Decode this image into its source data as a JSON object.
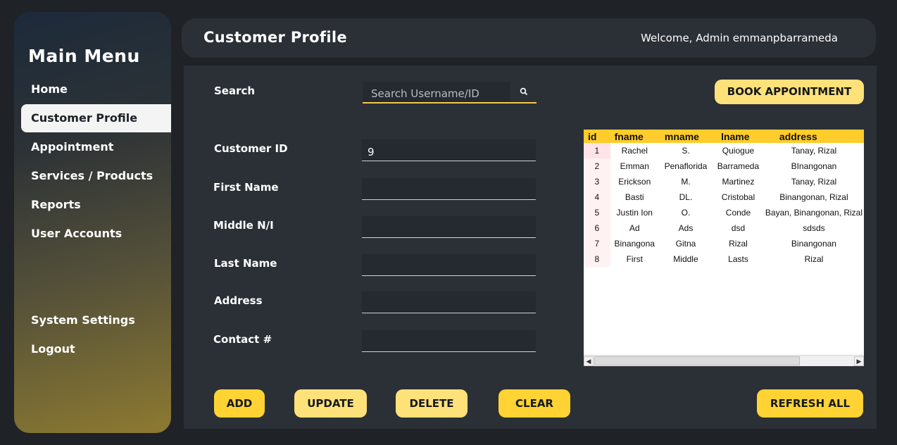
{
  "sidebar": {
    "title": "Main Menu",
    "items": [
      {
        "label": "Home"
      },
      {
        "label": "Customer Profile"
      },
      {
        "label": "Appointment"
      },
      {
        "label": "Services / Products"
      },
      {
        "label": "Reports"
      },
      {
        "label": "User Accounts"
      },
      {
        "label": "System Settings"
      },
      {
        "label": "Logout"
      }
    ],
    "active_index": 1
  },
  "header": {
    "title": "Customer Profile",
    "welcome": "Welcome, Admin emmanpbarrameda"
  },
  "search": {
    "label": "Search",
    "placeholder": "Search Username/ID",
    "icon": "search-icon"
  },
  "book_button": "BOOK APPOINTMENT",
  "form": {
    "customer_id_label": "Customer ID",
    "customer_id_value": "9",
    "first_name_label": "First Name",
    "first_name_value": "",
    "middle_label": "Middle N/I",
    "middle_value": "",
    "last_name_label": "Last Name",
    "last_name_value": "",
    "address_label": "Address",
    "address_value": "",
    "contact_label": "Contact #",
    "contact_value": ""
  },
  "table": {
    "columns": [
      "id",
      "fname",
      "mname",
      "lname",
      "address"
    ],
    "rows": [
      [
        "1",
        "Rachel",
        "S.",
        "Quiogue",
        "Tanay, Rizal"
      ],
      [
        "2",
        "Emman",
        "Penaflorida",
        "Barrameda",
        "BInangonan"
      ],
      [
        "3",
        "Erickson",
        "M.",
        "Martinez",
        "Tanay, Rizal"
      ],
      [
        "4",
        "Basti",
        "DL.",
        "Cristobal",
        "Binangonan, Rizal"
      ],
      [
        "5",
        "Justin Ion",
        "O.",
        "Conde",
        "Bayan, Binangonan, Rizal"
      ],
      [
        "6",
        "Ad",
        "Ads",
        "dsd",
        "sdsds"
      ],
      [
        "7",
        "Binangona",
        "Gitna",
        "Rizal",
        "Binangonan"
      ],
      [
        "8",
        "First",
        "Middle",
        "Lasts",
        "Rizal"
      ]
    ]
  },
  "buttons": {
    "add": "ADD",
    "update": "UPDATE",
    "delete": "DELETE",
    "clear": "CLEAR",
    "refresh": "REFRESH ALL"
  },
  "colors": {
    "accent_yellow": "#ffd334",
    "accent_light_yellow": "#ffe17a",
    "panel": "#2b2f36",
    "background": "#1f2226"
  }
}
